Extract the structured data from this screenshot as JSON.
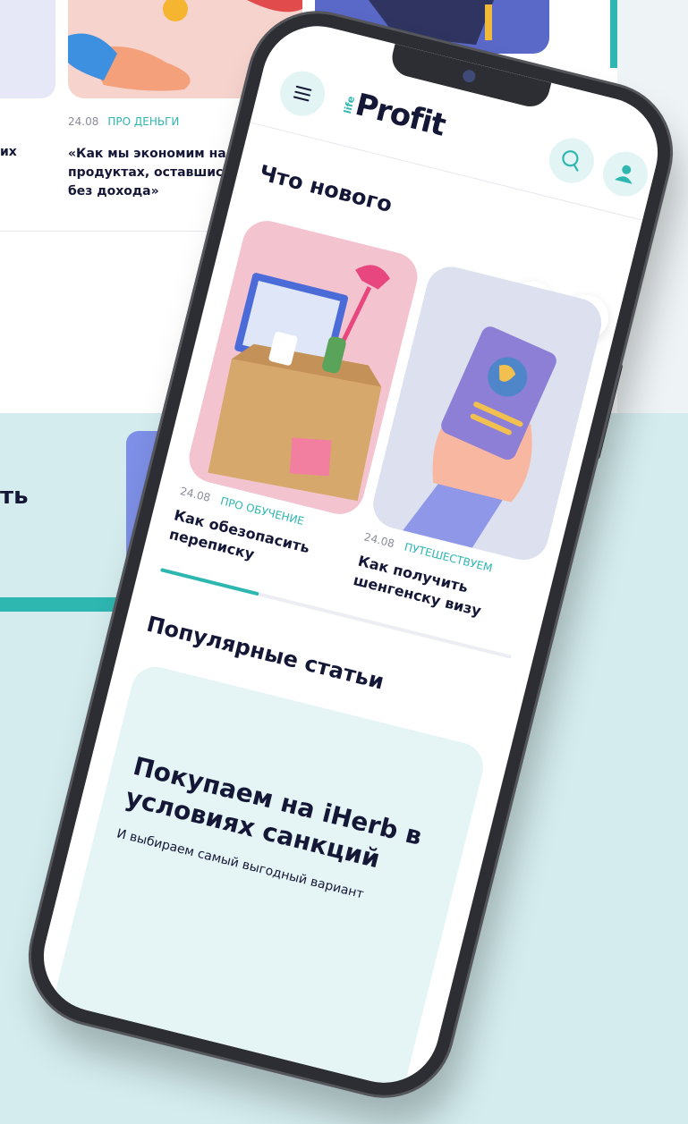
{
  "background_page": {
    "article": {
      "date": "24.08",
      "category": "ПРО ДЕНЬГИ",
      "title": "«Как мы экономим на продуктах, оставшись без дохода»"
    },
    "partial_left_text": "их",
    "partial_big_text": "ть"
  },
  "app": {
    "logo_prefix": "life",
    "logo_main": "Profit",
    "whats_new": {
      "heading": "Что нового",
      "cards": [
        {
          "date": "24.08",
          "category": "ПРО ОБУЧЕНИЕ",
          "title": "Как обезопасить переписку"
        },
        {
          "date": "24.08",
          "category": "ПУТЕШЕСТВУЕМ",
          "title": "Как получить шенгенску визу"
        }
      ],
      "progress": 0.28
    },
    "popular": {
      "heading": "Популярные статьи",
      "card_title": "Покупаем на iHerb в условиях санкций",
      "card_subtitle": "И выбираем самый выгодный вариант"
    }
  },
  "colors": {
    "accent": "#2eb6b0",
    "text": "#151736",
    "icon_bg": "#e3f4f4"
  }
}
